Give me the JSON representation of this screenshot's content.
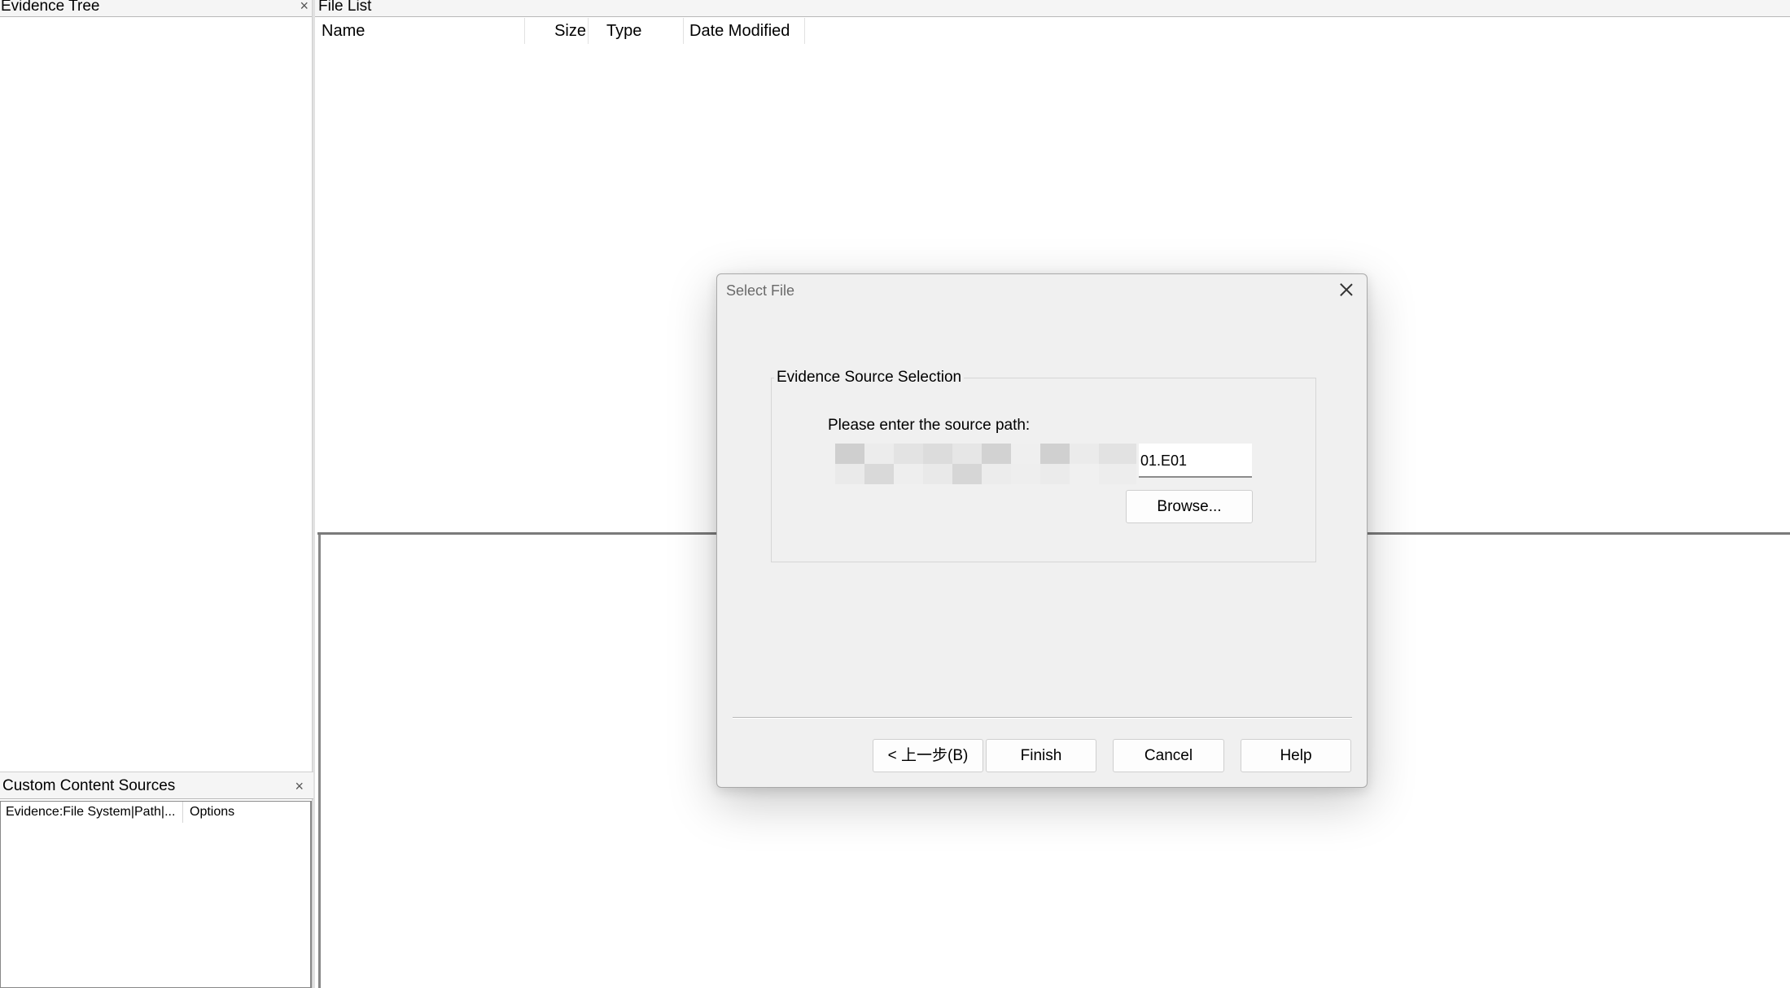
{
  "left_panel": {
    "evidence_tree": {
      "title": "Evidence Tree",
      "close_glyph": "×"
    },
    "custom_content_sources": {
      "title": "Custom Content Sources",
      "close_glyph": "×",
      "columns": [
        "Evidence:File System|Path|...",
        "Options"
      ]
    }
  },
  "file_list": {
    "title": "File List",
    "columns": {
      "name": "Name",
      "size": "Size",
      "type": "Type",
      "date_modified": "Date Modified"
    }
  },
  "dialog": {
    "title": "Select File",
    "group_label": "Evidence Source Selection",
    "prompt": "Please enter the source path:",
    "path_value": "01.E01",
    "buttons": {
      "browse": "Browse...",
      "back": "< 上一步(B)",
      "finish": "Finish",
      "cancel": "Cancel",
      "help": "Help"
    }
  },
  "colors": {
    "dialog_bg": "#f0f0f0",
    "panel_header_bg": "#f5f5f5",
    "splitter": "#7a7a7a"
  }
}
